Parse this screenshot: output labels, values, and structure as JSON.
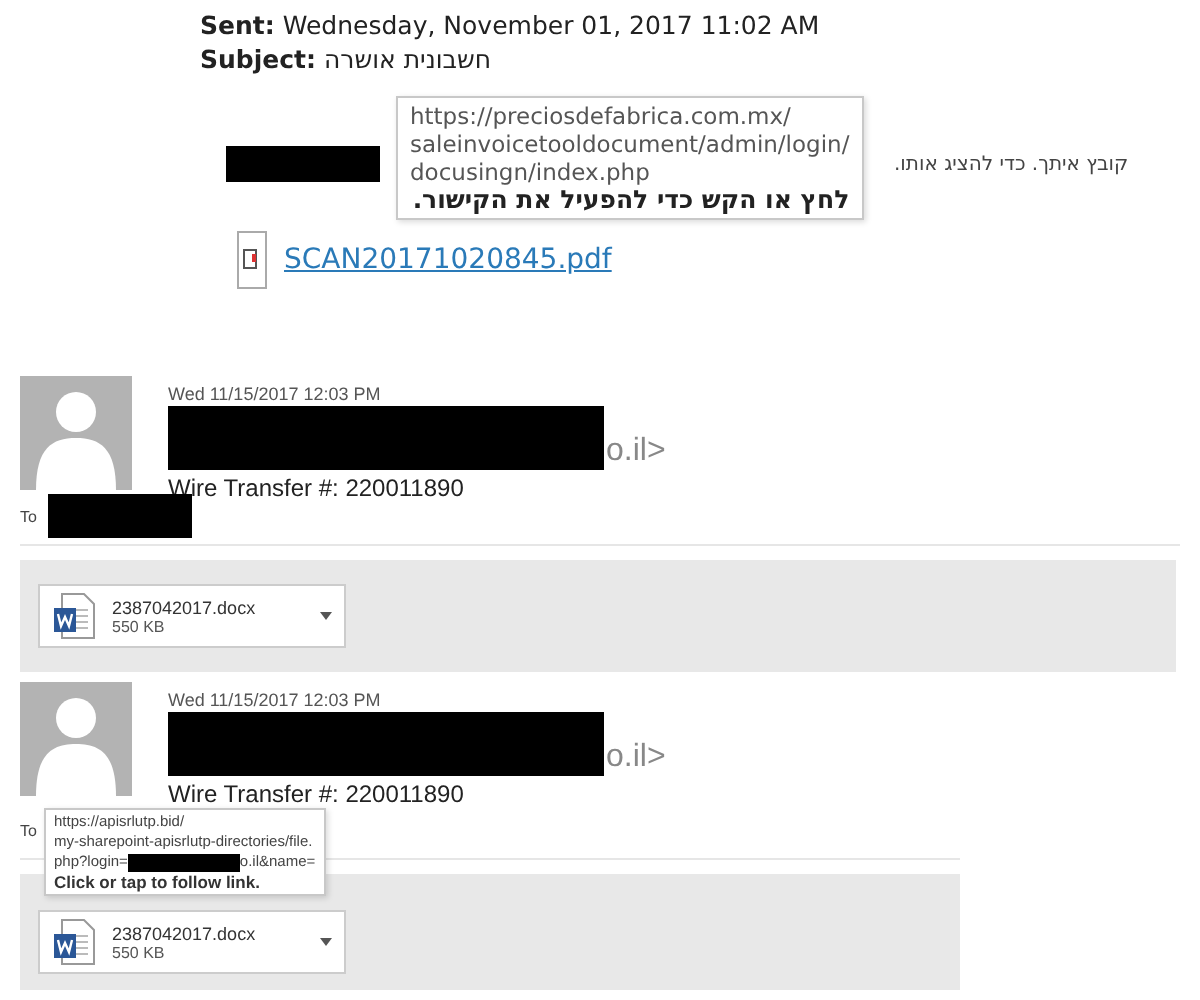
{
  "first_message": {
    "sent_label": "Sent:",
    "sent": "Wednesday, November 01, 2017 11:02 AM",
    "subject_label": "Subject:",
    "subject": "חשבונית אושרה",
    "body": "קובץ איתך. כדי להציג אותו.",
    "tooltip": {
      "lines": [
        "https://preciosdefabrica.com.mx/",
        "saleinvoicetooldocument/admin/login/",
        "docusingn/index.php"
      ],
      "hint": "לחץ או הקש כדי להפעיל את הקישור."
    },
    "attachment": "SCAN20171020845.pdf"
  },
  "messages": [
    {
      "date": "Wed 11/15/2017 12:03 PM",
      "sender_tail": "o.il>",
      "subject": "Wire Transfer #: 220011890",
      "to_label": "To",
      "attachments": [
        {
          "name": "2387042017.docx",
          "size": "550 KB"
        }
      ]
    },
    {
      "date": "Wed 11/15/2017 12:03 PM",
      "sender_tail": "o.il>",
      "subject": "Wire Transfer #: 220011890",
      "to_label": "To",
      "attachments": [
        {
          "name": "2387042017.docx",
          "size": "550 KB"
        }
      ],
      "tooltip": {
        "lines": [
          [
            {
              "text": "https://apisrlutp.bid/"
            }
          ],
          [
            {
              "text": "my-sharepoint-apisrlutp-directories/file."
            }
          ],
          [
            {
              "text": "php?login="
            },
            {
              "kind": "redacted"
            },
            {
              "text": "o.il&name="
            }
          ]
        ],
        "hint": "Click or tap to follow link."
      }
    }
  ]
}
